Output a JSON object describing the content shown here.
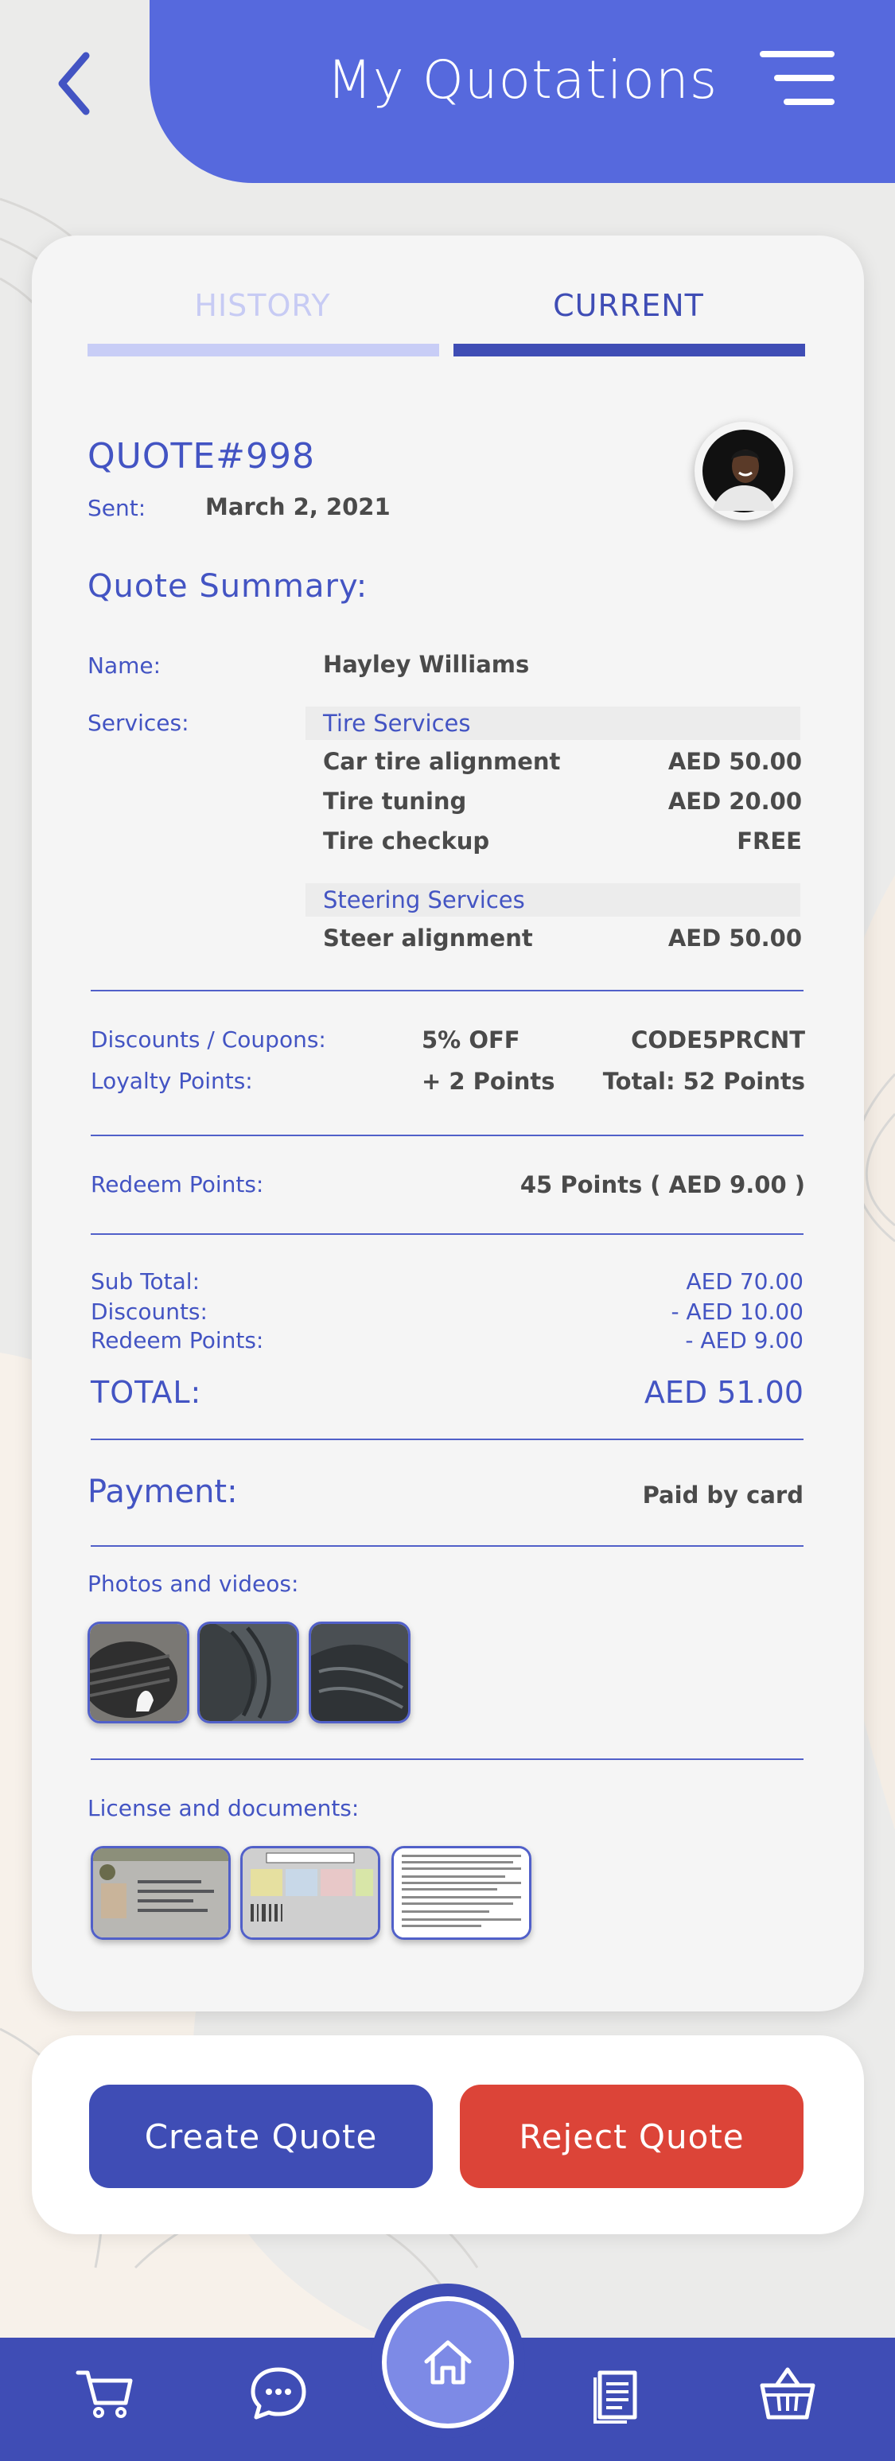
{
  "header": {
    "title": "My Quotations"
  },
  "tabs": [
    {
      "label": "HISTORY",
      "active": false
    },
    {
      "label": "CURRENT",
      "active": true
    }
  ],
  "quote": {
    "number": "QUOTE#998",
    "sent_label": "Sent:",
    "sent_date": "March 2, 2021"
  },
  "summary": {
    "title": "Quote Summary:",
    "name_label": "Name:",
    "name_value": "Hayley Williams",
    "services_label": "Services:",
    "categories": [
      {
        "name": "Tire Services",
        "items": [
          {
            "name": "Car tire alignment",
            "price": "AED 50.00"
          },
          {
            "name": "Tire tuning",
            "price": "AED 20.00"
          },
          {
            "name": "Tire checkup",
            "price": "FREE"
          }
        ]
      },
      {
        "name": "Steering Services",
        "items": [
          {
            "name": "Steer alignment",
            "price": "AED 50.00"
          }
        ]
      }
    ]
  },
  "discounts": {
    "label": "Discounts / Coupons:",
    "value": "5% OFF",
    "code": "CODE5PRCNT"
  },
  "loyalty": {
    "label": "Loyalty Points:",
    "value": "+ 2 Points",
    "total": "Total:  52 Points"
  },
  "redeem": {
    "label": "Redeem Points:",
    "value": "45 Points ( AED 9.00 )"
  },
  "totals": {
    "subtotal_label": "Sub Total:",
    "subtotal_value": "AED 70.00",
    "discounts_label": "Discounts:",
    "discounts_value": "- AED 10.00",
    "redeem_label": "Redeem Points:",
    "redeem_value": "- AED 9.00",
    "total_label": "TOTAL:",
    "total_value": "AED 51.00"
  },
  "payment": {
    "label": "Payment:",
    "value": "Paid by card"
  },
  "media": {
    "photos_label": "Photos and videos:",
    "documents_label": "License and documents:"
  },
  "actions": {
    "create_label": "Create Quote",
    "reject_label": "Reject Quote"
  },
  "colors": {
    "primary": "#3f4db5",
    "header": "#5669dd",
    "reject": "#dc4438",
    "text_blue": "#4354c3"
  },
  "nav": {
    "icons": [
      "cart-icon",
      "chat-icon",
      "home-icon",
      "documents-icon",
      "basket-icon"
    ]
  }
}
